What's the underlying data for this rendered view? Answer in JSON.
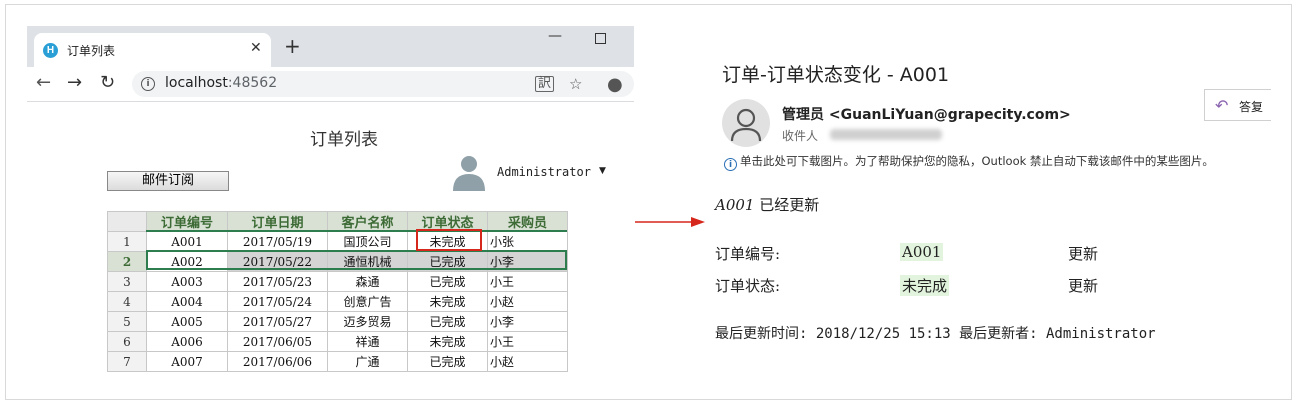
{
  "browser": {
    "tab_title": "订单列表",
    "tab_favicon_letter": "H",
    "url_host": "localhost",
    "url_port": ":48562"
  },
  "page": {
    "title": "订单列表",
    "subscribe_button": "邮件订阅",
    "user_name": "Administrator"
  },
  "table": {
    "headers": [
      "订单编号",
      "订单日期",
      "客户名称",
      "订单状态",
      "采购员"
    ],
    "rows": [
      {
        "num": "1",
        "cells": [
          "A001",
          "2017/05/19",
          "国顶公司",
          "未完成",
          "小张"
        ]
      },
      {
        "num": "2",
        "cells": [
          "A002",
          "2017/05/22",
          "通恒机械",
          "已完成",
          "小李"
        ]
      },
      {
        "num": "3",
        "cells": [
          "A003",
          "2017/05/23",
          "森通",
          "已完成",
          "小王"
        ]
      },
      {
        "num": "4",
        "cells": [
          "A004",
          "2017/05/24",
          "创意广告",
          "未完成",
          "小赵"
        ]
      },
      {
        "num": "5",
        "cells": [
          "A005",
          "2017/05/27",
          "迈多贸易",
          "已完成",
          "小李"
        ]
      },
      {
        "num": "6",
        "cells": [
          "A006",
          "2017/06/05",
          "祥通",
          "未完成",
          "小王"
        ]
      },
      {
        "num": "7",
        "cells": [
          "A007",
          "2017/06/06",
          "广通",
          "已完成",
          "小赵"
        ]
      }
    ],
    "selected_row": 2
  },
  "email": {
    "subject": "订单-订单状态变化 - A001",
    "sender_name": "管理员",
    "sender_address": "<GuanLiYuan@grapecity.com>",
    "to_label": "收件人",
    "reply_label": "答复",
    "notice": "单击此处可下载图片。为了帮助保护您的隐私，Outlook 禁止自动下载该邮件中的某些图片。",
    "intro_id": "A001",
    "intro_text": " 已经更新",
    "fields": [
      {
        "label": "订单编号:",
        "value": "A001",
        "status": "更新"
      },
      {
        "label": "订单状态:",
        "value": "未完成",
        "status": "更新"
      }
    ],
    "footer": "最后更新时间: 2018/12/25 15:13 最后更新者: Administrator"
  },
  "colors": {
    "header_green": "#3d6b35",
    "selection_outline": "#2e7d4f",
    "highlight_red": "#d6271c",
    "arrow_red": "#d6271c",
    "value_highlight": "#e2f4dd"
  }
}
